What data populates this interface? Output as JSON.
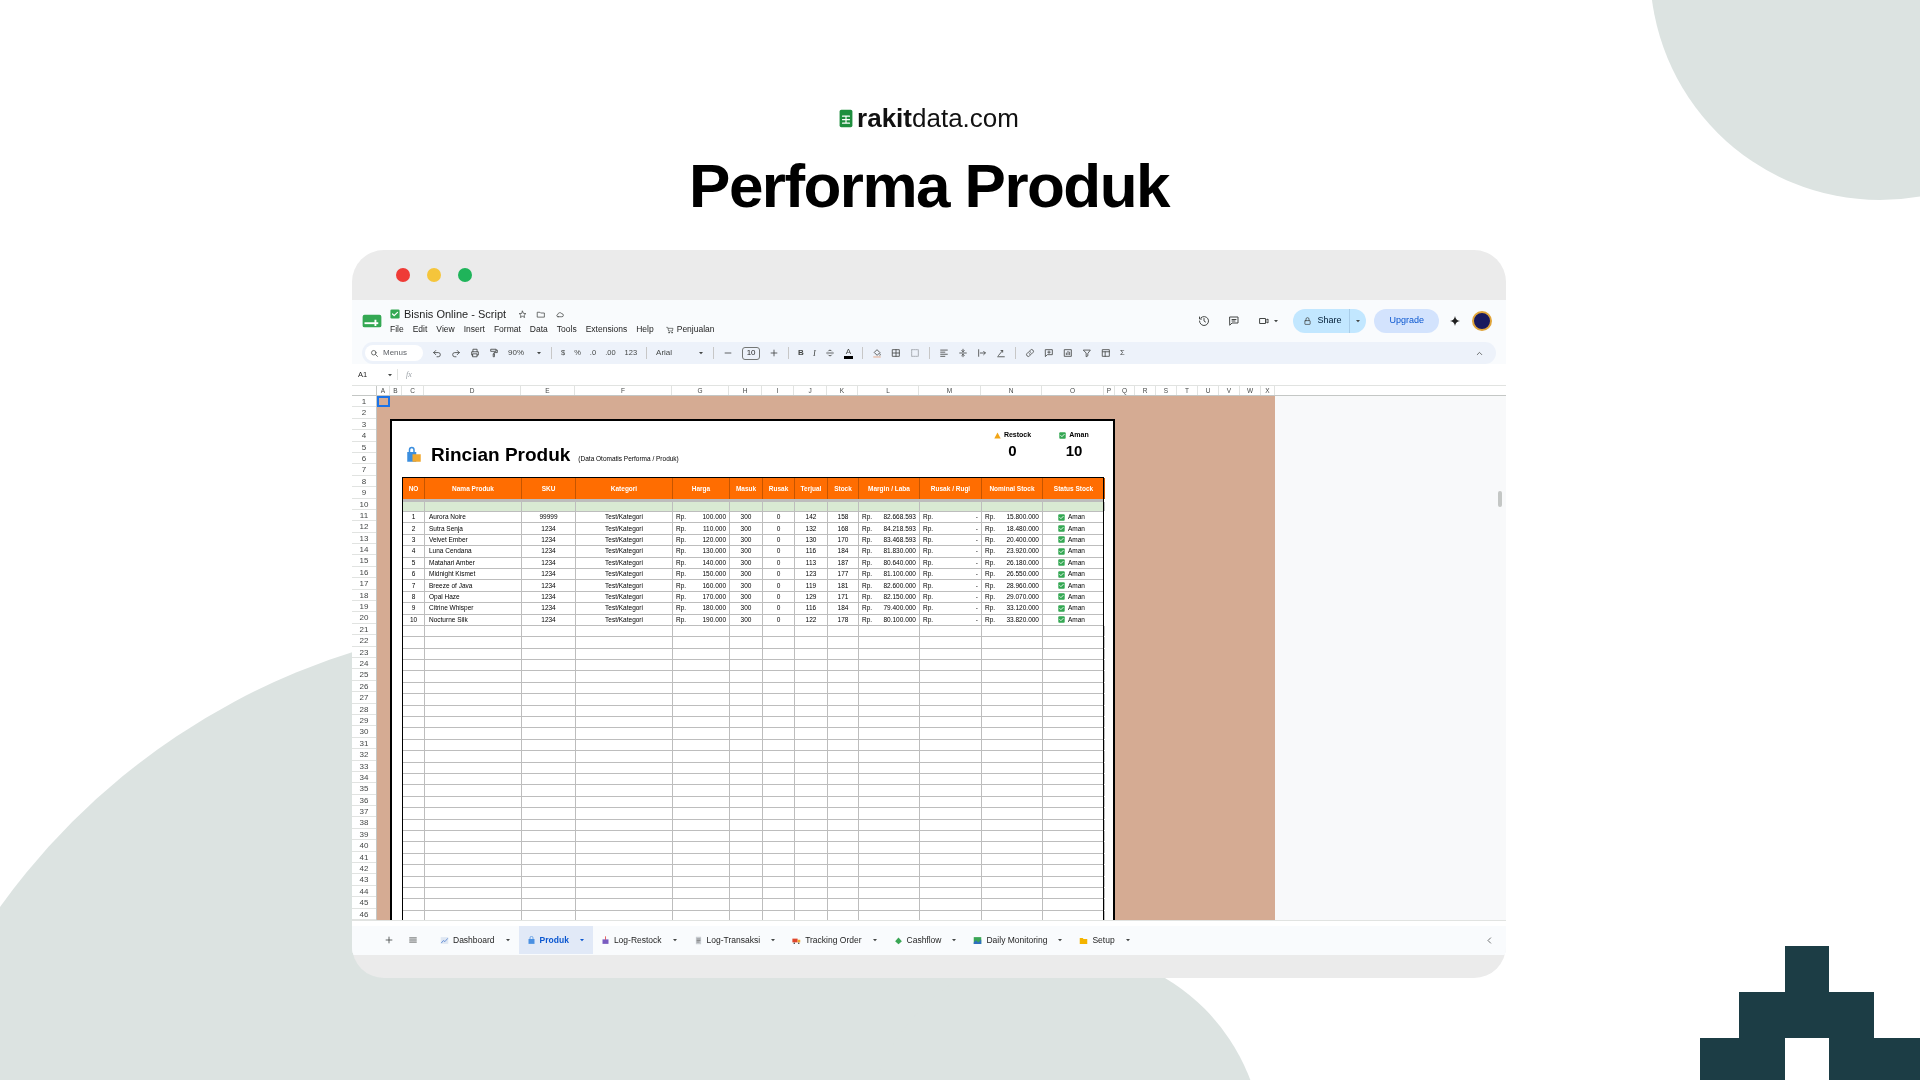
{
  "brand": {
    "text": "**rakit**data.com"
  },
  "headline": "Performa Produk",
  "app": {
    "title": "Bisnis Online - Script",
    "menus": [
      "File",
      "Edit",
      "View",
      "Insert",
      "Format",
      "Data",
      "Tools",
      "Extensions",
      "Help"
    ],
    "extension_menu": "Penjualan",
    "share": "Share",
    "upgrade": "Upgrade",
    "toolbar": [
      {
        "kind": "search",
        "text": "Menus"
      },
      {
        "kind": "undo"
      },
      {
        "kind": "redo"
      },
      {
        "kind": "print"
      },
      {
        "kind": "paint"
      },
      {
        "kind": "dropdown",
        "text": "90%"
      },
      {
        "kind": "divider"
      },
      {
        "kind": "text",
        "text": "$"
      },
      {
        "kind": "text",
        "text": "%"
      },
      {
        "kind": "text",
        "text": ".0"
      },
      {
        "kind": "text",
        "text": ".00"
      },
      {
        "kind": "text",
        "text": "123"
      },
      {
        "kind": "divider"
      },
      {
        "kind": "font",
        "text": "Arial"
      },
      {
        "kind": "divider"
      },
      {
        "kind": "minus"
      },
      {
        "kind": "size",
        "text": "10"
      },
      {
        "kind": "plus"
      },
      {
        "kind": "divider"
      },
      {
        "kind": "bold",
        "text": "B"
      },
      {
        "kind": "italic",
        "text": "I"
      },
      {
        "kind": "strike"
      },
      {
        "kind": "textcolor",
        "text": "A"
      },
      {
        "kind": "divider"
      },
      {
        "kind": "fill"
      },
      {
        "kind": "borders"
      },
      {
        "kind": "merge"
      },
      {
        "kind": "divider"
      },
      {
        "kind": "align"
      },
      {
        "kind": "valign"
      },
      {
        "kind": "wrap"
      },
      {
        "kind": "rotate"
      },
      {
        "kind": "divider"
      },
      {
        "kind": "link"
      },
      {
        "kind": "comment"
      },
      {
        "kind": "chart"
      },
      {
        "kind": "filter"
      },
      {
        "kind": "table"
      },
      {
        "kind": "text",
        "text": "Σ"
      }
    ],
    "name_box": "A1",
    "formula_label": "fx"
  },
  "column_letters": [
    "A",
    "B",
    "C",
    "D",
    "E",
    "F",
    "G",
    "H",
    "I",
    "J",
    "K",
    "L",
    "M",
    "N",
    "O",
    "P",
    "Q",
    "R",
    "S",
    "T",
    "U",
    "V",
    "W",
    "X"
  ],
  "row_numbers": [
    "1",
    "2",
    "3",
    "4",
    "5",
    "6",
    "7",
    "8",
    "9",
    "10",
    "11",
    "12",
    "13",
    "14",
    "15",
    "16",
    "17",
    "18",
    "19",
    "20",
    "21",
    "22",
    "23",
    "24",
    "25",
    "26",
    "27",
    "28",
    "29",
    "30",
    "31",
    "32",
    "33",
    "34",
    "35",
    "36",
    "37",
    "38",
    "39",
    "40",
    "41",
    "42",
    "43",
    "44",
    "45",
    "46"
  ],
  "report": {
    "title": "Rincian Produk",
    "subtitle": "(Data Otomatis Performa / Produk)",
    "summary": [
      {
        "kind": "warning",
        "label": "Restock",
        "value": "0"
      },
      {
        "kind": "check",
        "label": "Aman",
        "value": "10"
      }
    ],
    "columns": [
      "NO",
      "Nama Produk",
      "SKU",
      "Kategori",
      "Harga",
      "Masuk",
      "Rusak",
      "Terjual",
      "Stock",
      "Margin / Laba",
      "Rusak / Rugi",
      "Nominal Stock",
      "Status Stock"
    ],
    "rows": [
      {
        "cells": [
          "1",
          "Aurora Noire",
          "99999",
          "Test/Kategori",
          {
            "currency": "Rp.",
            "amount": "100.000"
          },
          "300",
          "0",
          "142",
          "158",
          {
            "currency": "Rp.",
            "amount": "82.668.593"
          },
          {
            "currency": "Rp.",
            "amount": "-"
          },
          {
            "currency": "Rp.",
            "amount": "15.800.000"
          }
        ],
        "status": {
          "label": "Aman",
          "checked": true
        }
      },
      {
        "cells": [
          "2",
          "Sutra Senja",
          "1234",
          "Test/Kategori",
          {
            "currency": "Rp.",
            "amount": "110.000"
          },
          "300",
          "0",
          "132",
          "168",
          {
            "currency": "Rp.",
            "amount": "84.218.593"
          },
          {
            "currency": "Rp.",
            "amount": "-"
          },
          {
            "currency": "Rp.",
            "amount": "18.480.000"
          }
        ],
        "status": {
          "label": "Aman",
          "checked": true
        }
      },
      {
        "cells": [
          "3",
          "Velvet Ember",
          "1234",
          "Test/Kategori",
          {
            "currency": "Rp.",
            "amount": "120.000"
          },
          "300",
          "0",
          "130",
          "170",
          {
            "currency": "Rp.",
            "amount": "83.468.593"
          },
          {
            "currency": "Rp.",
            "amount": "-"
          },
          {
            "currency": "Rp.",
            "amount": "20.400.000"
          }
        ],
        "status": {
          "label": "Aman",
          "checked": true
        }
      },
      {
        "cells": [
          "4",
          "Luna Cendana",
          "1234",
          "Test/Kategori",
          {
            "currency": "Rp.",
            "amount": "130.000"
          },
          "300",
          "0",
          "116",
          "184",
          {
            "currency": "Rp.",
            "amount": "81.830.000"
          },
          {
            "currency": "Rp.",
            "amount": "-"
          },
          {
            "currency": "Rp.",
            "amount": "23.920.000"
          }
        ],
        "status": {
          "label": "Aman",
          "checked": true
        }
      },
      {
        "cells": [
          "5",
          "Matahari Amber",
          "1234",
          "Test/Kategori",
          {
            "currency": "Rp.",
            "amount": "140.000"
          },
          "300",
          "0",
          "113",
          "187",
          {
            "currency": "Rp.",
            "amount": "80.640.000"
          },
          {
            "currency": "Rp.",
            "amount": "-"
          },
          {
            "currency": "Rp.",
            "amount": "26.180.000"
          }
        ],
        "status": {
          "label": "Aman",
          "checked": true
        }
      },
      {
        "cells": [
          "6",
          "Midnight Kismet",
          "1234",
          "Test/Kategori",
          {
            "currency": "Rp.",
            "amount": "150.000"
          },
          "300",
          "0",
          "123",
          "177",
          {
            "currency": "Rp.",
            "amount": "81.100.000"
          },
          {
            "currency": "Rp.",
            "amount": "-"
          },
          {
            "currency": "Rp.",
            "amount": "26.550.000"
          }
        ],
        "status": {
          "label": "Aman",
          "checked": true
        }
      },
      {
        "cells": [
          "7",
          "Breeze of Java",
          "1234",
          "Test/Kategori",
          {
            "currency": "Rp.",
            "amount": "160.000"
          },
          "300",
          "0",
          "119",
          "181",
          {
            "currency": "Rp.",
            "amount": "82.600.000"
          },
          {
            "currency": "Rp.",
            "amount": "-"
          },
          {
            "currency": "Rp.",
            "amount": "28.960.000"
          }
        ],
        "status": {
          "label": "Aman",
          "checked": true
        }
      },
      {
        "cells": [
          "8",
          "Opal Haze",
          "1234",
          "Test/Kategori",
          {
            "currency": "Rp.",
            "amount": "170.000"
          },
          "300",
          "0",
          "129",
          "171",
          {
            "currency": "Rp.",
            "amount": "82.150.000"
          },
          {
            "currency": "Rp.",
            "amount": "-"
          },
          {
            "currency": "Rp.",
            "amount": "29.070.000"
          }
        ],
        "status": {
          "label": "Aman",
          "checked": true
        }
      },
      {
        "cells": [
          "9",
          "Citrine Whisper",
          "1234",
          "Test/Kategori",
          {
            "currency": "Rp.",
            "amount": "180.000"
          },
          "300",
          "0",
          "116",
          "184",
          {
            "currency": "Rp.",
            "amount": "79.400.000"
          },
          {
            "currency": "Rp.",
            "amount": "-"
          },
          {
            "currency": "Rp.",
            "amount": "33.120.000"
          }
        ],
        "status": {
          "label": "Aman",
          "checked": true
        }
      },
      {
        "cells": [
          "10",
          "Nocturne Silk",
          "1234",
          "Test/Kategori",
          {
            "currency": "Rp.",
            "amount": "190.000"
          },
          "300",
          "0",
          "122",
          "178",
          {
            "currency": "Rp.",
            "amount": "80.100.000"
          },
          {
            "currency": "Rp.",
            "amount": "-"
          },
          {
            "currency": "Rp.",
            "amount": "33.820.000"
          }
        ],
        "status": {
          "label": "Aman",
          "checked": true
        }
      }
    ]
  },
  "sheet_tabs": [
    {
      "kind": "chart",
      "label": "Dashboard",
      "selected": false
    },
    {
      "kind": "bag",
      "label": "Produk",
      "selected": true
    },
    {
      "kind": "box",
      "label": "Log-Restock",
      "selected": false
    },
    {
      "kind": "doc",
      "label": "Log-Transaksi",
      "selected": false
    },
    {
      "kind": "truck",
      "label": "Tracking Order",
      "selected": false
    },
    {
      "kind": "money",
      "label": "Cashflow",
      "selected": false
    },
    {
      "kind": "picture",
      "label": "Daily Monitoring",
      "selected": false
    },
    {
      "kind": "folder",
      "label": "Setup",
      "selected": false
    }
  ]
}
